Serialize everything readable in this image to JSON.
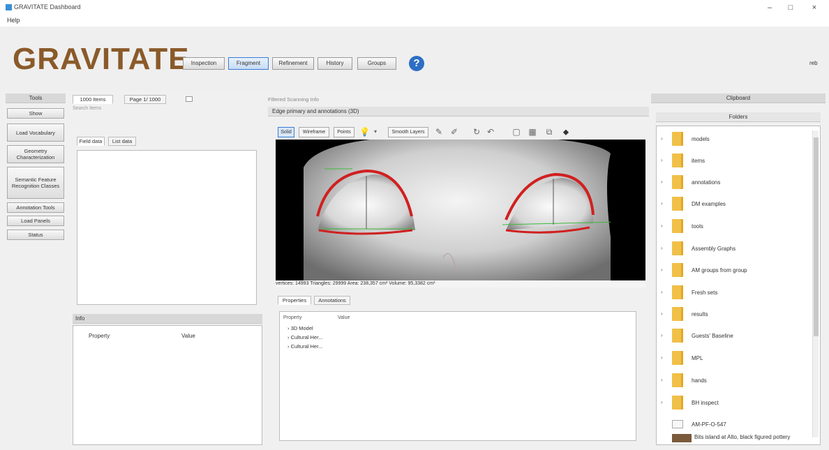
{
  "window": {
    "title": "GRAVITATE Dashboard",
    "minimize": "–",
    "maximize": "□",
    "close": "×"
  },
  "menu": {
    "help": "Help"
  },
  "banner": {
    "logo": "GRAVITATE",
    "nav": [
      "Inspection",
      "Fragment",
      "Refinement",
      "History",
      "Groups"
    ],
    "active_nav": "Fragment",
    "help_glyph": "?",
    "right_label": "reb"
  },
  "left_sidebar": {
    "header": "Tools",
    "buttons": [
      "Show",
      "Load Vocabulary",
      "Geometry Characterization",
      "Semantic Feature Recognition Classes",
      "Annotation Tools",
      "Load Panels",
      "Status"
    ]
  },
  "list_panel": {
    "tabs": [
      "1000 Items",
      "Page 1/ 1000"
    ],
    "search_label": "Search Items",
    "field_tabs": [
      "Field data",
      "List data"
    ],
    "info_header": "Info",
    "columns": [
      "Property",
      "Value"
    ]
  },
  "top_info": {
    "label": "Filtered Scanning Info"
  },
  "viewer": {
    "header": "Edge primary and annotations (3D)",
    "toolbar": [
      "Solid",
      "Wireframe",
      "Points",
      "Smooth Layers"
    ],
    "status": "vertices: 14993     Triangles: 29999   Area: 238,357 cm²   Volume: 95,3382 cm³",
    "bottom_tabs": [
      "Properties",
      "Annotations"
    ],
    "prop_columns": [
      "Property",
      "Value"
    ],
    "tree": [
      "3D Model",
      "Cultural Her...",
      "Cultural Her..."
    ]
  },
  "right_panel": {
    "header": "Clipboard",
    "subheader": "Folders",
    "folders": [
      "models",
      "items",
      "annotations",
      "DM examples",
      "tools",
      "Assembly Graphs",
      "AM groups from group",
      "Fresh sets",
      "results",
      "Guests' Baseline",
      "MPL",
      "hands",
      "BH inspect"
    ],
    "files": [
      {
        "name": "AM-PF-O-547",
        "kind": "file"
      },
      {
        "name": "Bits island at Alto, black figured pottery",
        "kind": "image"
      }
    ]
  },
  "colors": {
    "accent": "#2d6fc5",
    "logo": "#8a5a2a",
    "folder": "#f0c048",
    "annotation": "#d02020",
    "mesh_green": "#3cbb3c"
  }
}
